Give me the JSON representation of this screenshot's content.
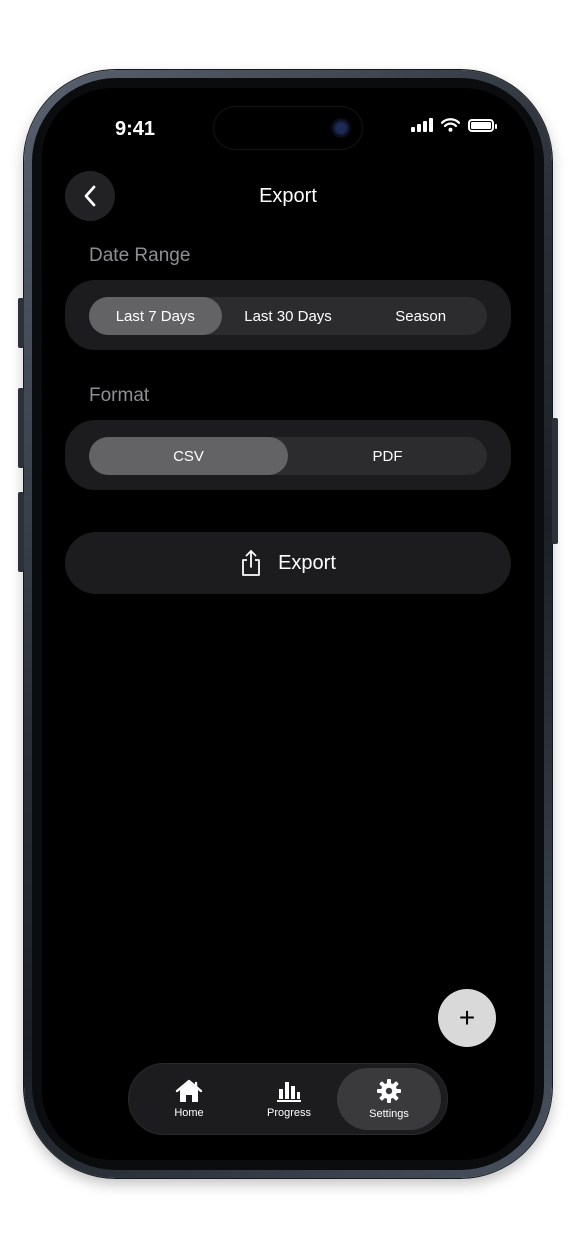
{
  "status_bar": {
    "time": "9:41"
  },
  "nav": {
    "title": "Export",
    "back_icon": "chevron-left-icon"
  },
  "date_range": {
    "label": "Date Range",
    "options": [
      "Last 7 Days",
      "Last 30 Days",
      "Season"
    ],
    "selected": "Last 7 Days"
  },
  "format": {
    "label": "Format",
    "options": [
      "CSV",
      "PDF"
    ],
    "selected": "CSV"
  },
  "export_button": {
    "label": "Export",
    "icon": "share-icon"
  },
  "fab": {
    "label": "+",
    "icon": "plus-icon"
  },
  "tabbar": {
    "items": [
      {
        "label": "Home",
        "icon": "house-icon"
      },
      {
        "label": "Progress",
        "icon": "bar-chart-icon"
      },
      {
        "label": "Settings",
        "icon": "gear-icon"
      }
    ],
    "active": "Settings"
  },
  "colors": {
    "background": "#000000",
    "card": "#1c1c1e",
    "segment_track": "#2c2c2e",
    "segment_active": "#636366",
    "label": "#8e8e93",
    "fab": "#d9d9d9"
  }
}
